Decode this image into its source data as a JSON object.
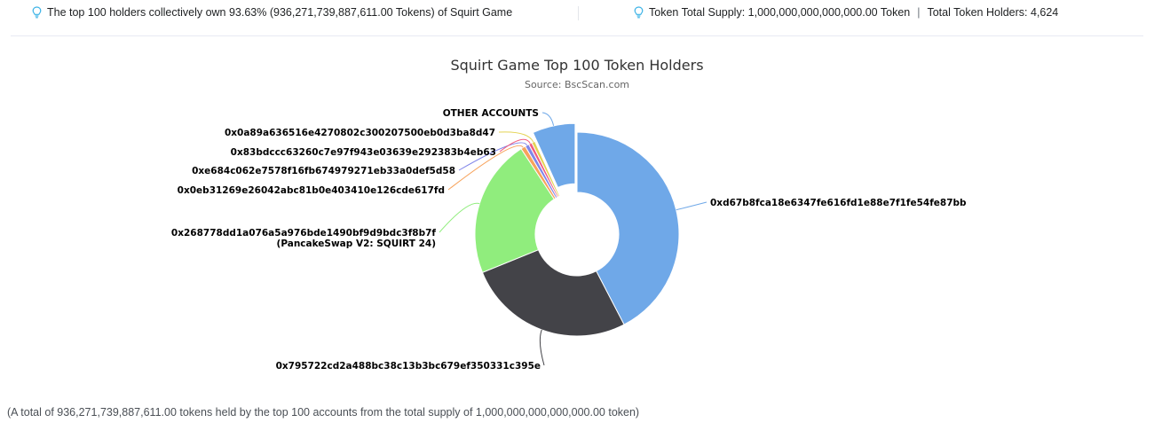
{
  "header": {
    "left_text": "The top 100 holders collectively own 93.63% (936,271,739,887,611.00 Tokens) of Squirt Game",
    "supply_text": "Token Total Supply: 1,000,000,000,000,000.00 Token",
    "separator": "|",
    "holders_text": "Total Token Holders: 4,624",
    "bulb_icon": "lightbulb-icon",
    "bulb_color": "#3ab2e6"
  },
  "chart_data": {
    "type": "pie",
    "title": "Squirt Game Top 100 Token Holders",
    "subtitle": "Source: BscScan.com",
    "variant": "donut",
    "slices": [
      {
        "label": "0xd67b8fca18e6347fe616fd1e88e7f1fe54fe87bb",
        "label2": "",
        "value": 40.0,
        "color": "#6fa8e8"
      },
      {
        "label": "0x795722cd2a488bc38c13b3bc679ef350331c395e",
        "label2": "",
        "value": 25.0,
        "color": "#434348"
      },
      {
        "label": "0x268778dd1a076a5a976bde1490bf9d9bdc3f8b7f",
        "label2": "(PancakeSwap V2: SQUIRT 24)",
        "value": 20.7,
        "color": "#90ed7d"
      },
      {
        "label": "0x0eb31269e26042abc81b0e403410e126cde617fd",
        "label2": "",
        "value": 0.7,
        "color": "#f7a35c"
      },
      {
        "label": "0xe684c062e7578f16fb674979271eb33a0def5d58",
        "label2": "",
        "value": 0.6,
        "color": "#8085e9"
      },
      {
        "label": "0x83bdccc63260c7e97f943e03639e292383b4eb63",
        "label2": "",
        "value": 0.5,
        "color": "#f15c80"
      },
      {
        "label": "0x0a89a636516e4270802c300207500eb0d3ba8d47",
        "label2": "",
        "value": 0.5,
        "color": "#e4d354"
      },
      {
        "label": "OTHER ACCOUNTS",
        "label2": "",
        "value": 6.4,
        "color": "#6fa8e8",
        "sliced": true
      }
    ]
  },
  "footer": {
    "text": "(A total of 936,271,739,887,611.00 tokens held by the top 100 accounts from the total supply of 1,000,000,000,000,000.00 token)"
  }
}
